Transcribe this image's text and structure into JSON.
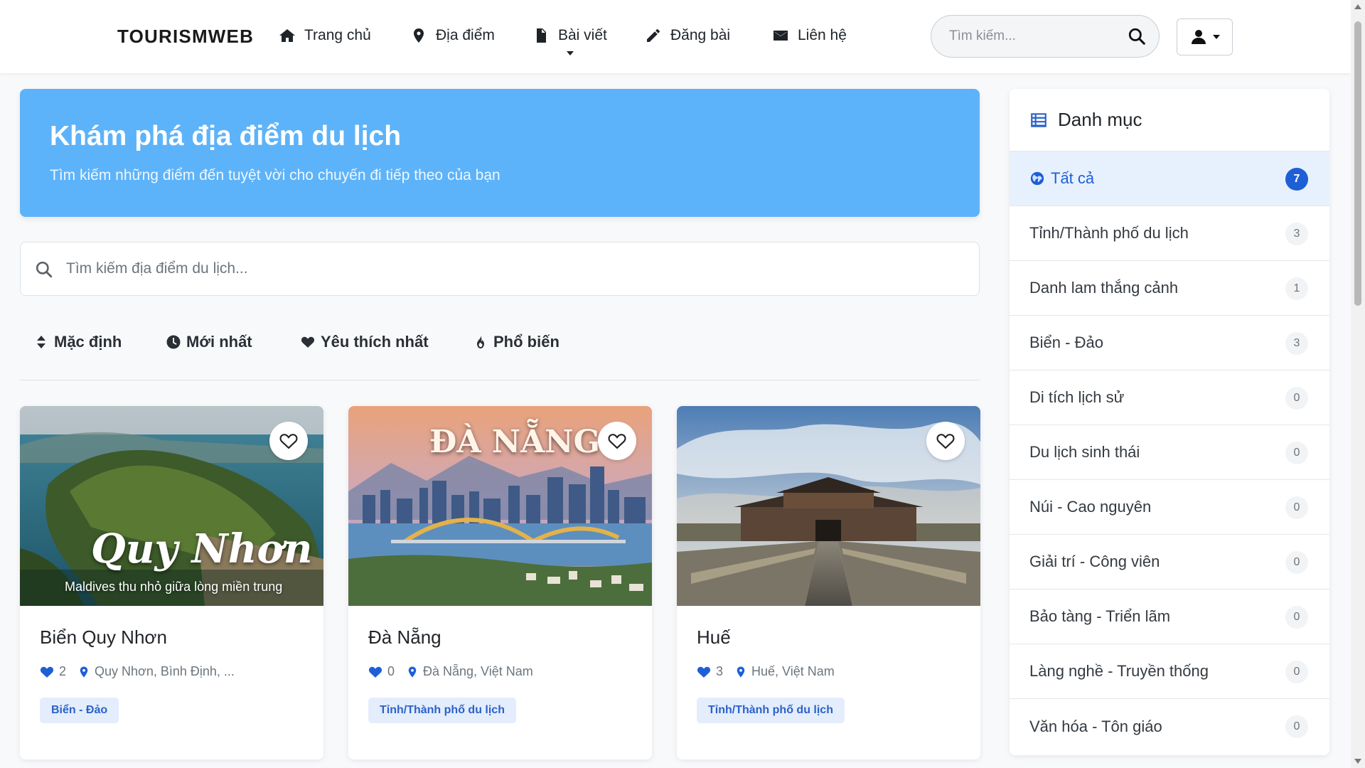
{
  "brand": "TOURISMWEB",
  "nav": {
    "home": "Trang chủ",
    "places": "Địa điểm",
    "posts": "Bài viết",
    "create_post": "Đăng bài",
    "contact": "Liên hệ"
  },
  "header_search": {
    "placeholder": "Tìm kiếm..."
  },
  "hero": {
    "title": "Khám phá địa điểm du lịch",
    "subtitle": "Tìm kiếm những điểm đến tuyệt vời cho chuyến đi tiếp theo của bạn"
  },
  "main_search": {
    "placeholder": "Tìm kiếm địa điểm du lịch..."
  },
  "sort": {
    "default": "Mặc định",
    "newest": "Mới nhất",
    "most_liked": "Yêu thích nhất",
    "popular": "Phổ biến"
  },
  "cards": [
    {
      "title": "Biển Quy Nhơn",
      "likes": "2",
      "location": "Quy Nhơn, Bình Định, ...",
      "category": "Biển - Đảo",
      "overlay_title": "Quy Nhơn",
      "overlay_subtitle": "Maldives thu nhỏ giữa lòng miền trung"
    },
    {
      "title": "Đà Nẵng",
      "likes": "0",
      "location": "Đà Nẵng, Việt Nam",
      "category": "Tỉnh/Thành phố du lịch",
      "overlay_title": "ĐÀ NẴNG"
    },
    {
      "title": "Huế",
      "likes": "3",
      "location": "Huế, Việt Nam",
      "category": "Tỉnh/Thành phố du lịch"
    }
  ],
  "sidebar": {
    "title": "Danh mục",
    "items": [
      {
        "label": "Tất cả",
        "count": "7"
      },
      {
        "label": "Tỉnh/Thành phố du lịch",
        "count": "3"
      },
      {
        "label": "Danh lam thắng cảnh",
        "count": "1"
      },
      {
        "label": "Biển - Đảo",
        "count": "3"
      },
      {
        "label": "Di tích lịch sử",
        "count": "0"
      },
      {
        "label": "Du lịch sinh thái",
        "count": "0"
      },
      {
        "label": "Núi - Cao nguyên",
        "count": "0"
      },
      {
        "label": "Giải trí - Công viên",
        "count": "0"
      },
      {
        "label": "Bảo tàng - Triển lãm",
        "count": "0"
      },
      {
        "label": "Làng nghề - Truyền thống",
        "count": "0"
      },
      {
        "label": "Văn hóa - Tôn giáo",
        "count": "0"
      }
    ]
  },
  "colors": {
    "accent": "#1e5fd6",
    "hero_bg": "#5db3f9",
    "badge_bg": "#e4edfc"
  }
}
